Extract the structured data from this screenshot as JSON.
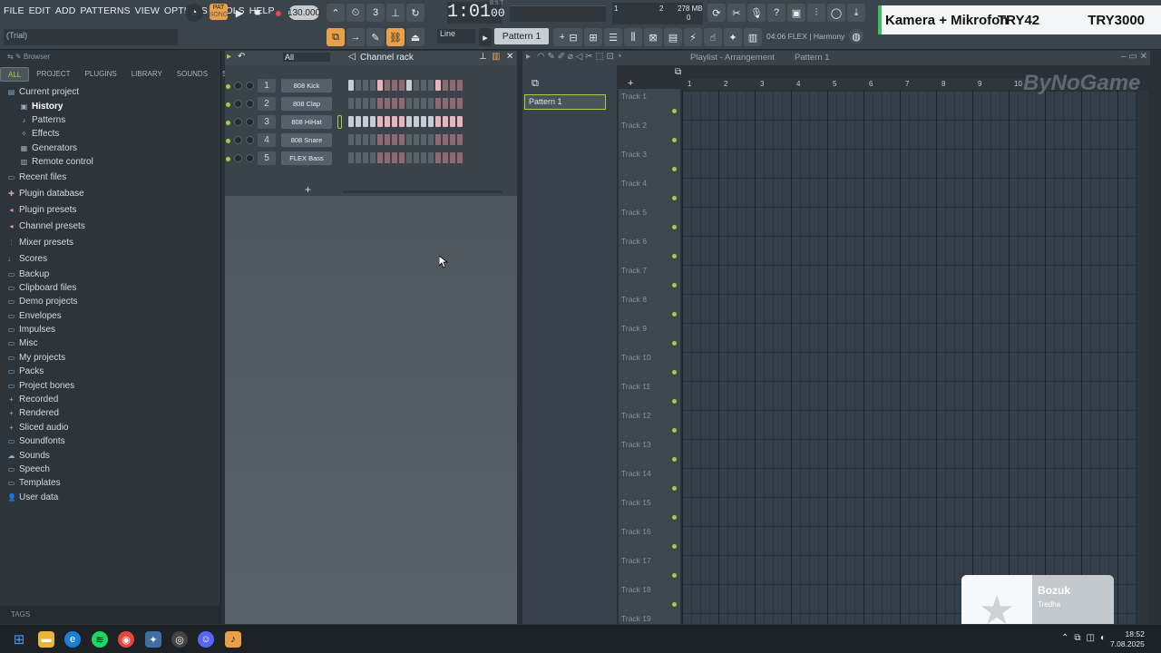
{
  "menu": [
    "FILE",
    "EDIT",
    "ADD",
    "PATTERNS",
    "VIEW",
    "OPTIONS",
    "TOOLS",
    "HELP"
  ],
  "title_hint": "(Trial)",
  "transport": {
    "pat_label": "PAT",
    "song_label": "SONG",
    "bpm": "130.000",
    "time": "1:01",
    "time_sub": "00",
    "bst": "B:S:T"
  },
  "cpu": {
    "cores": "2",
    "ram": "278 MB",
    "val": "0",
    "one": "1"
  },
  "pattern_selector": "Pattern 1",
  "snap": "Line",
  "hint": "04:06  FLEX | Harmony",
  "overlay": {
    "left": "Kamera + Mikrofon",
    "mid": "TRY42",
    "right": "TRY3000"
  },
  "browser": {
    "title": "Browser",
    "tabs": [
      "ALL",
      "PROJECT",
      "PLUGINS",
      "LIBRARY",
      "SOUNDS",
      "STARRED"
    ],
    "items": [
      {
        "label": "Current project",
        "icon": "folder-open-icon",
        "depth": 0
      },
      {
        "label": "History",
        "icon": "history-icon",
        "depth": 1,
        "sel": true
      },
      {
        "label": "Patterns",
        "icon": "note-icon",
        "depth": 1
      },
      {
        "label": "Effects",
        "icon": "effects-icon",
        "depth": 1
      },
      {
        "label": "Generators",
        "icon": "generator-icon",
        "depth": 1
      },
      {
        "label": "Remote control",
        "icon": "remote-icon",
        "depth": 1
      },
      {
        "label": "Recent files",
        "icon": "folder-icon",
        "depth": 0
      },
      {
        "label": "Plugin database",
        "icon": "plug-icon",
        "depth": 0
      },
      {
        "label": "Plugin presets",
        "icon": "preset-icon",
        "depth": 0
      },
      {
        "label": "Channel presets",
        "icon": "preset-icon",
        "depth": 0
      },
      {
        "label": "Mixer presets",
        "icon": "mixer-icon",
        "depth": 0
      },
      {
        "label": "Scores",
        "icon": "score-icon",
        "depth": 0
      },
      {
        "label": "Backup",
        "icon": "folder-icon",
        "depth": 0
      },
      {
        "label": "Clipboard files",
        "icon": "folder-icon",
        "depth": 0
      },
      {
        "label": "Demo projects",
        "icon": "folder-icon",
        "depth": 0
      },
      {
        "label": "Envelopes",
        "icon": "folder-icon",
        "depth": 0
      },
      {
        "label": "Impulses",
        "icon": "folder-icon",
        "depth": 0
      },
      {
        "label": "Misc",
        "icon": "folder-icon",
        "depth": 0
      },
      {
        "label": "My projects",
        "icon": "folder-icon",
        "depth": 0
      },
      {
        "label": "Packs",
        "icon": "folder-icon",
        "depth": 0
      },
      {
        "label": "Project bones",
        "icon": "folder-icon",
        "depth": 0
      },
      {
        "label": "Recorded",
        "icon": "plus-icon",
        "depth": 0
      },
      {
        "label": "Rendered",
        "icon": "plus-icon",
        "depth": 0
      },
      {
        "label": "Sliced audio",
        "icon": "plus-icon",
        "depth": 0
      },
      {
        "label": "Soundfonts",
        "icon": "folder-icon",
        "depth": 0
      },
      {
        "label": "Sounds",
        "icon": "cloud-icon",
        "depth": 0
      },
      {
        "label": "Speech",
        "icon": "folder-icon",
        "depth": 0
      },
      {
        "label": "Templates",
        "icon": "folder-icon",
        "depth": 0
      },
      {
        "label": "User data",
        "icon": "user-icon",
        "depth": 0
      }
    ],
    "tags_label": "TAGS"
  },
  "rack": {
    "title": "Channel rack",
    "filter": "All",
    "add": "+",
    "channels": [
      {
        "num": "1",
        "name": "808 Kick",
        "steps": [
          1,
          0,
          0,
          0,
          2,
          0,
          0,
          0,
          1,
          0,
          0,
          0,
          2,
          0,
          0,
          0
        ]
      },
      {
        "num": "2",
        "name": "808 Clap",
        "steps": [
          0,
          0,
          0,
          0,
          0,
          0,
          0,
          0,
          0,
          0,
          0,
          0,
          0,
          0,
          0,
          0
        ]
      },
      {
        "num": "3",
        "name": "808 HiHat",
        "steps": [
          1,
          1,
          1,
          1,
          2,
          2,
          2,
          2,
          1,
          1,
          1,
          1,
          2,
          2,
          2,
          2
        ]
      },
      {
        "num": "4",
        "name": "808 Snare",
        "steps": [
          0,
          0,
          0,
          0,
          0,
          0,
          0,
          0,
          0,
          0,
          0,
          0,
          0,
          0,
          0,
          0
        ]
      },
      {
        "num": "5",
        "name": "FLEX Bass",
        "steps": [
          0,
          0,
          0,
          0,
          0,
          0,
          0,
          0,
          0,
          0,
          0,
          0,
          0,
          0,
          0,
          0
        ]
      }
    ]
  },
  "playlist": {
    "title": "Playlist - Arrangement",
    "pattern": "Pattern 1",
    "pattern_item": "Pattern 1",
    "add": "+",
    "ruler": [
      "1",
      "2",
      "3",
      "4",
      "5",
      "6",
      "7",
      "8",
      "9",
      "10"
    ],
    "tracks": [
      "Track 1",
      "Track 2",
      "Track 3",
      "Track 4",
      "Track 5",
      "Track 6",
      "Track 7",
      "Track 8",
      "Track 9",
      "Track 10",
      "Track 11",
      "Track 12",
      "Track 13",
      "Track 14",
      "Track 15",
      "Track 16",
      "Track 17",
      "Track 18",
      "Track 19"
    ]
  },
  "watermark": "ByNoGame",
  "toast": {
    "title": "Bozuk",
    "subtitle": "Tredha"
  },
  "clock": {
    "time": "18:52",
    "date": "7.08.2025"
  },
  "colors": {
    "accent": "#9fd14a",
    "record": "#e5484d",
    "overlay_bar": "#3fbf62",
    "step_lit": "#c6ccd2",
    "step_red": "#e7b4c0"
  }
}
